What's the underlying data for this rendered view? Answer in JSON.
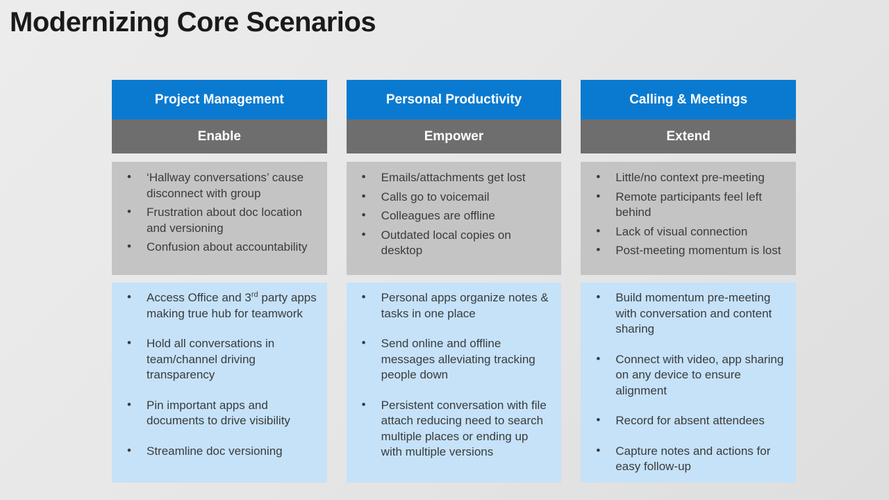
{
  "slide": {
    "title": "Modernizing Core Scenarios",
    "theme": {
      "accent_blue": "#0a7ad1",
      "header_gray": "#6e6e6e",
      "problem_panel": "#c4c4c4",
      "benefit_panel": "#c5e2f9",
      "background": "#e8e8e8",
      "body_text": "#3b3b3b"
    }
  },
  "columns": [
    {
      "scenario": "Project Management",
      "action": "Enable",
      "problems": [
        "‘Hallway conversations’ cause disconnect with group",
        "Frustration about doc location and versioning",
        "Confusion about accountability"
      ],
      "benefits": [
        "Access Office and 3rd party apps making true hub for teamwork",
        "Hold all conversations in team/channel driving transparency",
        "Pin important apps and documents to drive visibility",
        "Streamline doc versioning"
      ]
    },
    {
      "scenario": "Personal Productivity",
      "action": "Empower",
      "problems": [
        "Emails/attachments get lost",
        "Calls go to voicemail",
        "Colleagues are offline",
        "Outdated local copies on desktop"
      ],
      "benefits": [
        "Personal apps organize notes & tasks in one place",
        "Send online and offline messages alleviating tracking people down",
        "Persistent conversation with file attach reducing need to search multiple places or ending up with multiple versions"
      ]
    },
    {
      "scenario": "Calling & Meetings",
      "action": "Extend",
      "problems": [
        "Little/no context pre-meeting",
        "Remote  participants feel left behind",
        "Lack of visual connection",
        "Post-meeting momentum is lost"
      ],
      "benefits": [
        "Build momentum pre-meeting with conversation and content sharing",
        "Connect with video, app sharing on any device to ensure alignment",
        "Record for absent attendees",
        "Capture notes and actions for easy follow-up"
      ]
    }
  ]
}
